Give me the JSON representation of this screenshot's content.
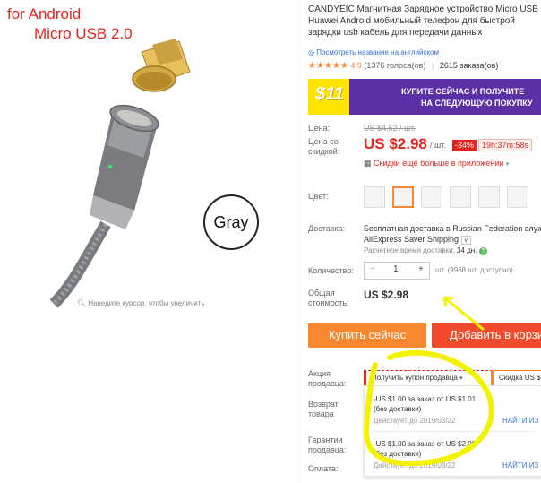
{
  "image": {
    "badge_line1": "for Android",
    "badge_line2": "Micro USB 2.0",
    "color_label": "Gray",
    "zoom_hint": "Наведите курсор, чтобы увеличить"
  },
  "product": {
    "title": "CANDYEIC Магнитная Зарядное устройство Micro USB Huawei Android мобильный телефон для быстрой зарядки usb кабель для передачи данных",
    "translate_link": "Посмотреть название на английском",
    "rating": "4.9",
    "reviews": "(1376 голоса(ов)",
    "orders": "2615 заказа(ов)"
  },
  "promo": {
    "amount": "$11",
    "line1": "КУПИТЕ СЕЙЧАС И ПОЛУЧИТЕ",
    "line2": "НА СЛЕДУЮЩУЮ ПОКУПКУ"
  },
  "price": {
    "price_label": "Цена:",
    "old_price": "US $4.52 / шт.",
    "discount_label": "Цена со скидкой:",
    "new_price": "US $2.98",
    "unit": "/ шт.",
    "discount": "-34%",
    "timer": "19h:37m:58s",
    "app_deal": "Скидки ещё больше в приложении"
  },
  "color": {
    "label": "Цвет:"
  },
  "shipping": {
    "label": "Доставка:",
    "line1": "Бесплатная доставка в Russian Federation службой",
    "line2": "AliExpress Saver Shipping",
    "eta_prefix": "Расчетное время доставки:",
    "eta_value": "34 дн."
  },
  "quantity": {
    "label": "Количество:",
    "minus": "−",
    "value": "1",
    "plus": "+",
    "available": "шт. (9968 шт. доступно)"
  },
  "total": {
    "label": "Общая стоимость:",
    "value": "US $2.98"
  },
  "buttons": {
    "buy_now": "Купить сейчас",
    "add_to_cart": "Добавить в корзину"
  },
  "seller_promo": {
    "label": "Акция продавца:",
    "coupon_dropdown": "Получить купон продавца",
    "store_discount": "Скидка US $"
  },
  "returns": {
    "label": "Возврат товара"
  },
  "guarantees": {
    "label": "Гарантии продавца:"
  },
  "payment": {
    "label": "Оплата:"
  },
  "coupons": [
    {
      "line1": "-US $1.00 за заказ от US $1.01",
      "line2": "(без доставки)",
      "valid": "Действует до 2019/03/22",
      "action": "НАЙТИ ИЗ"
    },
    {
      "line1": "-US $1.00 за заказ от US $2.00",
      "line2": "(без доставки)",
      "valid": "Действует до 2019/03/22",
      "action": "НАЙТИ ИЗ"
    }
  ],
  "colors": {
    "accent_orange": "#f7882f",
    "accent_red": "#ef4b2c",
    "promo_purple": "#5b2fa6",
    "promo_yellow": "#ffe400",
    "annotation_yellow": "#f3f300",
    "link_blue": "#3a6fd6"
  }
}
